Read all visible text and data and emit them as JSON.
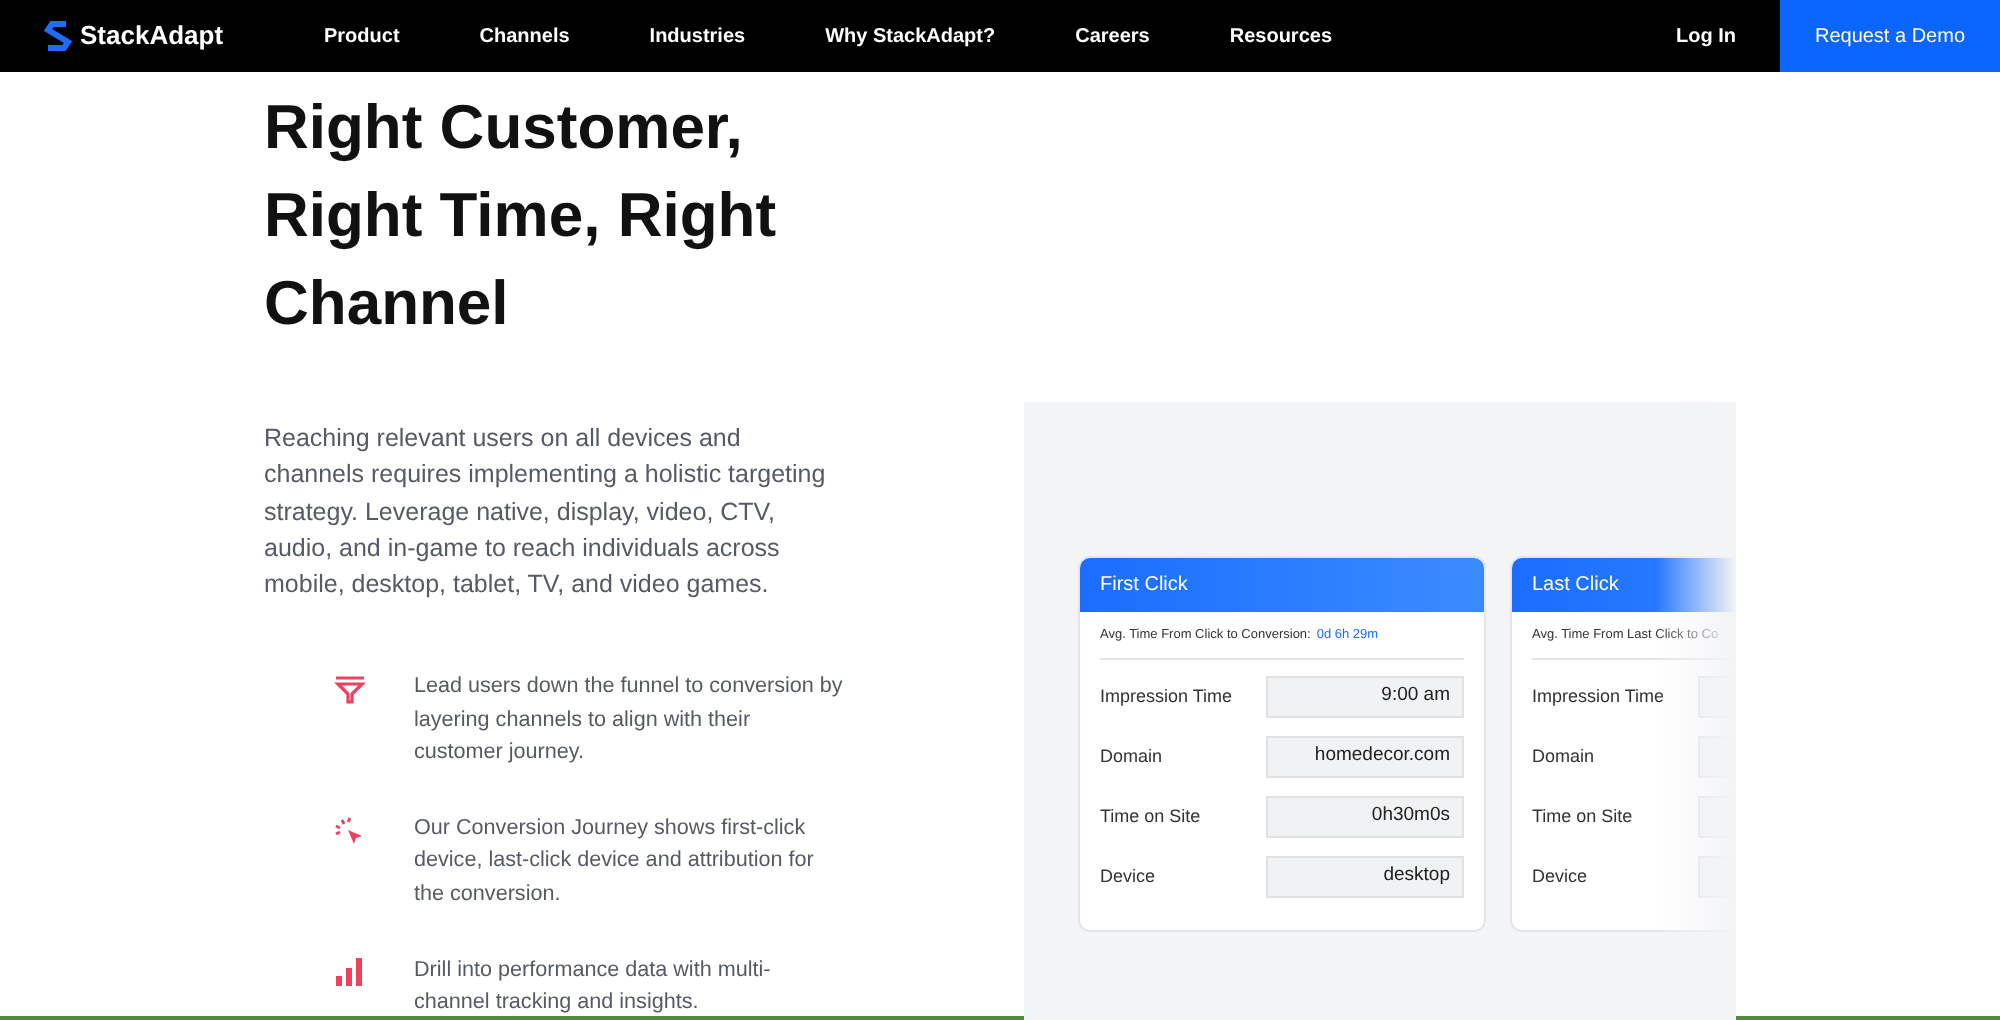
{
  "nav": {
    "logo": "StackAdapt",
    "links": [
      "Product",
      "Channels",
      "Industries",
      "Why StackAdapt?",
      "Careers",
      "Resources"
    ],
    "login": "Log In",
    "cta": "Request a Demo"
  },
  "hero": {
    "title": [
      "Right Customer,",
      "Right Time, Right",
      "Channel"
    ],
    "intro": "Reaching relevant users on all devices and channels requires implementing a holistic targeting strategy. Leverage native, display, video, CTV, audio, and in-game to reach individuals across mobile, desktop, tablet, TV, and video games."
  },
  "features": [
    {
      "kind": "funnel",
      "text": "Lead users down the funnel to conversion by layering channels to align with their customer journey."
    },
    {
      "kind": "click",
      "text": "Our Conversion Journey shows first-click device, last-click device and attribution for the conversion."
    },
    {
      "kind": "bars",
      "text": "Drill into performance data with multi-channel tracking and insights."
    }
  ],
  "cards": [
    {
      "title": "First Click",
      "avg_label": "Avg. Time From Click to Conversion:",
      "avg_value": "0d 6h 29m",
      "rows": [
        {
          "label": "Impression Time",
          "value": "9:00 am"
        },
        {
          "label": "Domain",
          "value": "homedecor.com"
        },
        {
          "label": "Time on Site",
          "value": "0h30m0s"
        },
        {
          "label": "Device",
          "value": "desktop"
        }
      ]
    },
    {
      "title": "Last Click",
      "avg_label": "Avg. Time From Last Click to Co",
      "rows": [
        {
          "label": "Impression Time"
        },
        {
          "label": "Domain"
        },
        {
          "label": "Time on Site"
        },
        {
          "label": "Device"
        }
      ]
    }
  ]
}
